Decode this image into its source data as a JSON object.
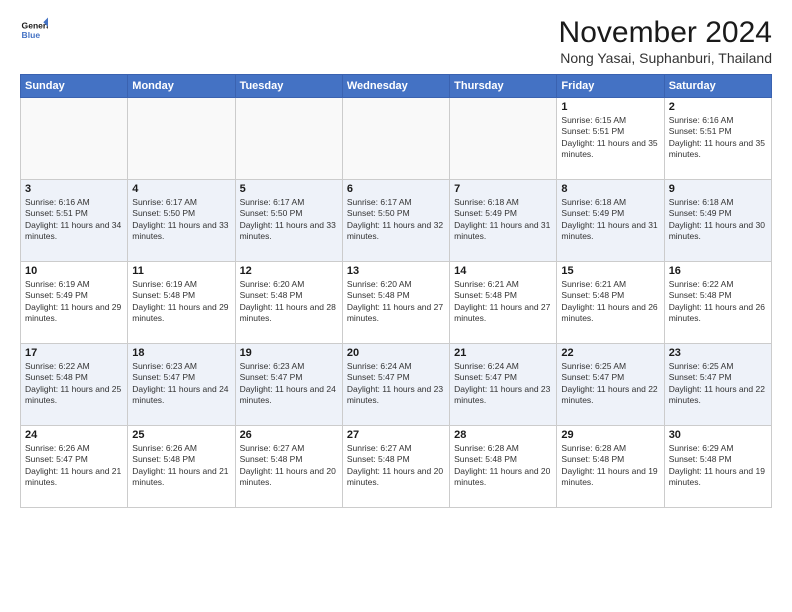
{
  "logo": {
    "line1": "General",
    "line2": "Blue"
  },
  "title": "November 2024",
  "location": "Nong Yasai, Suphanburi, Thailand",
  "days_of_week": [
    "Sunday",
    "Monday",
    "Tuesday",
    "Wednesday",
    "Thursday",
    "Friday",
    "Saturday"
  ],
  "weeks": [
    [
      {
        "day": "",
        "info": ""
      },
      {
        "day": "",
        "info": ""
      },
      {
        "day": "",
        "info": ""
      },
      {
        "day": "",
        "info": ""
      },
      {
        "day": "",
        "info": ""
      },
      {
        "day": "1",
        "info": "Sunrise: 6:15 AM\nSunset: 5:51 PM\nDaylight: 11 hours and 35 minutes."
      },
      {
        "day": "2",
        "info": "Sunrise: 6:16 AM\nSunset: 5:51 PM\nDaylight: 11 hours and 35 minutes."
      }
    ],
    [
      {
        "day": "3",
        "info": "Sunrise: 6:16 AM\nSunset: 5:51 PM\nDaylight: 11 hours and 34 minutes."
      },
      {
        "day": "4",
        "info": "Sunrise: 6:17 AM\nSunset: 5:50 PM\nDaylight: 11 hours and 33 minutes."
      },
      {
        "day": "5",
        "info": "Sunrise: 6:17 AM\nSunset: 5:50 PM\nDaylight: 11 hours and 33 minutes."
      },
      {
        "day": "6",
        "info": "Sunrise: 6:17 AM\nSunset: 5:50 PM\nDaylight: 11 hours and 32 minutes."
      },
      {
        "day": "7",
        "info": "Sunrise: 6:18 AM\nSunset: 5:49 PM\nDaylight: 11 hours and 31 minutes."
      },
      {
        "day": "8",
        "info": "Sunrise: 6:18 AM\nSunset: 5:49 PM\nDaylight: 11 hours and 31 minutes."
      },
      {
        "day": "9",
        "info": "Sunrise: 6:18 AM\nSunset: 5:49 PM\nDaylight: 11 hours and 30 minutes."
      }
    ],
    [
      {
        "day": "10",
        "info": "Sunrise: 6:19 AM\nSunset: 5:49 PM\nDaylight: 11 hours and 29 minutes."
      },
      {
        "day": "11",
        "info": "Sunrise: 6:19 AM\nSunset: 5:48 PM\nDaylight: 11 hours and 29 minutes."
      },
      {
        "day": "12",
        "info": "Sunrise: 6:20 AM\nSunset: 5:48 PM\nDaylight: 11 hours and 28 minutes."
      },
      {
        "day": "13",
        "info": "Sunrise: 6:20 AM\nSunset: 5:48 PM\nDaylight: 11 hours and 27 minutes."
      },
      {
        "day": "14",
        "info": "Sunrise: 6:21 AM\nSunset: 5:48 PM\nDaylight: 11 hours and 27 minutes."
      },
      {
        "day": "15",
        "info": "Sunrise: 6:21 AM\nSunset: 5:48 PM\nDaylight: 11 hours and 26 minutes."
      },
      {
        "day": "16",
        "info": "Sunrise: 6:22 AM\nSunset: 5:48 PM\nDaylight: 11 hours and 26 minutes."
      }
    ],
    [
      {
        "day": "17",
        "info": "Sunrise: 6:22 AM\nSunset: 5:48 PM\nDaylight: 11 hours and 25 minutes."
      },
      {
        "day": "18",
        "info": "Sunrise: 6:23 AM\nSunset: 5:47 PM\nDaylight: 11 hours and 24 minutes."
      },
      {
        "day": "19",
        "info": "Sunrise: 6:23 AM\nSunset: 5:47 PM\nDaylight: 11 hours and 24 minutes."
      },
      {
        "day": "20",
        "info": "Sunrise: 6:24 AM\nSunset: 5:47 PM\nDaylight: 11 hours and 23 minutes."
      },
      {
        "day": "21",
        "info": "Sunrise: 6:24 AM\nSunset: 5:47 PM\nDaylight: 11 hours and 23 minutes."
      },
      {
        "day": "22",
        "info": "Sunrise: 6:25 AM\nSunset: 5:47 PM\nDaylight: 11 hours and 22 minutes."
      },
      {
        "day": "23",
        "info": "Sunrise: 6:25 AM\nSunset: 5:47 PM\nDaylight: 11 hours and 22 minutes."
      }
    ],
    [
      {
        "day": "24",
        "info": "Sunrise: 6:26 AM\nSunset: 5:47 PM\nDaylight: 11 hours and 21 minutes."
      },
      {
        "day": "25",
        "info": "Sunrise: 6:26 AM\nSunset: 5:48 PM\nDaylight: 11 hours and 21 minutes."
      },
      {
        "day": "26",
        "info": "Sunrise: 6:27 AM\nSunset: 5:48 PM\nDaylight: 11 hours and 20 minutes."
      },
      {
        "day": "27",
        "info": "Sunrise: 6:27 AM\nSunset: 5:48 PM\nDaylight: 11 hours and 20 minutes."
      },
      {
        "day": "28",
        "info": "Sunrise: 6:28 AM\nSunset: 5:48 PM\nDaylight: 11 hours and 20 minutes."
      },
      {
        "day": "29",
        "info": "Sunrise: 6:28 AM\nSunset: 5:48 PM\nDaylight: 11 hours and 19 minutes."
      },
      {
        "day": "30",
        "info": "Sunrise: 6:29 AM\nSunset: 5:48 PM\nDaylight: 11 hours and 19 minutes."
      }
    ]
  ]
}
